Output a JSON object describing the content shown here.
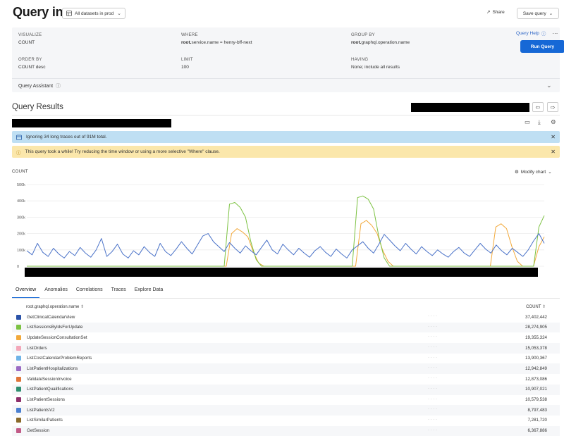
{
  "header": {
    "title": "Query in",
    "dataset_label": "All datasets in prod",
    "share_label": "Share",
    "save_query_label": "Save query"
  },
  "query": {
    "visualize_heading": "VISUALIZE",
    "visualize_value": "COUNT",
    "where_heading": "WHERE",
    "where_field": "root.",
    "where_rest": "service.name = henry-bff-next",
    "group_by_heading": "GROUP BY",
    "group_by_field": "root.",
    "group_by_rest": "graphql.operation.name",
    "order_by_heading": "ORDER BY",
    "order_by_value": "COUNT desc",
    "limit_heading": "LIMIT",
    "limit_value": "100",
    "having_heading": "HAVING",
    "having_value": "None; include all results",
    "help_label": "Query Help",
    "run_label": "Run Query",
    "assistant_label": "Query Assistant"
  },
  "results": {
    "title": "Query Results",
    "banner_info": "Ignoring 34 long traces out of 91M total.",
    "banner_warning": "This query took a while! Try reducing the time window or using a more selective \"Where\" clause.",
    "count_label": "COUNT",
    "modify_chart_label": "Modify chart"
  },
  "tabs": [
    "Overview",
    "Anomalies",
    "Correlations",
    "Traces",
    "Explore Data"
  ],
  "table": {
    "col_name": "root.graphql.operation.name",
    "col_count": "COUNT",
    "rows": [
      {
        "name": "GetClinicalCalendarView",
        "count": "37,402,442",
        "color": "#2a52a8"
      },
      {
        "name": "ListSessionsByIdsForUpdate",
        "count": "28,274,905",
        "color": "#7cc242"
      },
      {
        "name": "UpdateSessionConsultationSet",
        "count": "19,355,324",
        "color": "#f2a93b"
      },
      {
        "name": "ListOrders",
        "count": "15,053,378",
        "color": "#f4a7b9"
      },
      {
        "name": "ListCostCalendarProblemReports",
        "count": "13,900,367",
        "color": "#6fb4e8"
      },
      {
        "name": "ListPatientHospitalizations",
        "count": "12,942,849",
        "color": "#9b6bc4"
      },
      {
        "name": "ValidateSessionInvoice",
        "count": "12,873,086",
        "color": "#e0763a"
      },
      {
        "name": "ListPatientQualifications",
        "count": "10,907,021",
        "color": "#2f8f6f"
      },
      {
        "name": "ListPatientSessions",
        "count": "10,579,538",
        "color": "#8e2f6b"
      },
      {
        "name": "ListPatientsV2",
        "count": "8,797,483",
        "color": "#4a7fd0"
      },
      {
        "name": "ListSimilarPatients",
        "count": "7,281,720",
        "color": "#8a6a2a"
      },
      {
        "name": "GetSession",
        "count": "6,367,886",
        "color": "#c25a87"
      }
    ]
  },
  "chart_data": {
    "type": "line",
    "ylabel": "COUNT",
    "yticks": [
      "500k",
      "400k",
      "300k",
      "200k",
      "100k",
      "0"
    ],
    "ylim": [
      0,
      500000
    ],
    "series": [
      {
        "name": "GetClinicalCalendarView",
        "color": "#4a72c8",
        "values": [
          95000,
          70000,
          140000,
          85000,
          60000,
          110000,
          75000,
          50000,
          90000,
          65000,
          115000,
          80000,
          55000,
          100000,
          170000,
          60000,
          90000,
          135000,
          75000,
          50000,
          95000,
          70000,
          120000,
          85000,
          60000,
          140000,
          90000,
          65000,
          105000,
          150000,
          110000,
          75000,
          130000,
          185000,
          200000,
          150000,
          120000,
          90000,
          145000,
          110000,
          80000,
          125000,
          95000,
          70000,
          115000,
          160000,
          100000,
          75000,
          135000,
          100000,
          70000,
          110000,
          80000,
          55000,
          95000,
          120000,
          85000,
          60000,
          105000,
          75000,
          50000,
          100000,
          125000,
          150000,
          110000,
          80000,
          135000,
          195000,
          160000,
          125000,
          95000,
          140000,
          105000,
          75000,
          120000,
          90000,
          65000,
          100000,
          75000,
          55000,
          90000,
          115000,
          80000,
          60000,
          100000,
          140000,
          105000,
          80000,
          130000,
          95000,
          70000,
          110000,
          85000,
          60000,
          100000,
          155000,
          200000,
          140000
        ]
      },
      {
        "name": "ListSessionsByIdsForUpdate",
        "color": "#7cc242",
        "values": [
          0,
          0,
          0,
          0,
          0,
          0,
          0,
          0,
          0,
          0,
          0,
          0,
          0,
          0,
          0,
          0,
          0,
          0,
          0,
          0,
          0,
          0,
          0,
          0,
          0,
          0,
          0,
          0,
          0,
          0,
          0,
          0,
          0,
          0,
          0,
          0,
          0,
          0,
          380000,
          390000,
          360000,
          300000,
          150000,
          40000,
          0,
          0,
          0,
          0,
          0,
          0,
          0,
          0,
          0,
          0,
          0,
          0,
          0,
          0,
          0,
          0,
          0,
          0,
          420000,
          430000,
          410000,
          350000,
          180000,
          50000,
          0,
          0,
          0,
          0,
          0,
          0,
          0,
          0,
          0,
          0,
          0,
          0,
          0,
          0,
          0,
          0,
          0,
          0,
          0,
          0,
          0,
          0,
          0,
          0,
          0,
          0,
          0,
          0,
          240000,
          310000
        ]
      },
      {
        "name": "UpdateSessionConsultationSet",
        "color": "#f2a93b",
        "values": [
          0,
          0,
          0,
          0,
          0,
          0,
          0,
          0,
          0,
          0,
          0,
          0,
          0,
          0,
          0,
          0,
          0,
          0,
          0,
          0,
          0,
          0,
          0,
          0,
          0,
          0,
          0,
          0,
          0,
          0,
          0,
          0,
          0,
          0,
          0,
          0,
          0,
          0,
          200000,
          230000,
          210000,
          180000,
          90000,
          20000,
          0,
          0,
          0,
          0,
          0,
          0,
          0,
          0,
          0,
          0,
          0,
          0,
          0,
          0,
          0,
          0,
          0,
          0,
          260000,
          280000,
          250000,
          200000,
          100000,
          30000,
          0,
          0,
          0,
          0,
          0,
          0,
          0,
          0,
          0,
          0,
          0,
          0,
          0,
          0,
          0,
          0,
          0,
          0,
          0,
          240000,
          260000,
          230000,
          120000,
          30000,
          0,
          0,
          0,
          120000,
          180000
        ]
      }
    ]
  }
}
